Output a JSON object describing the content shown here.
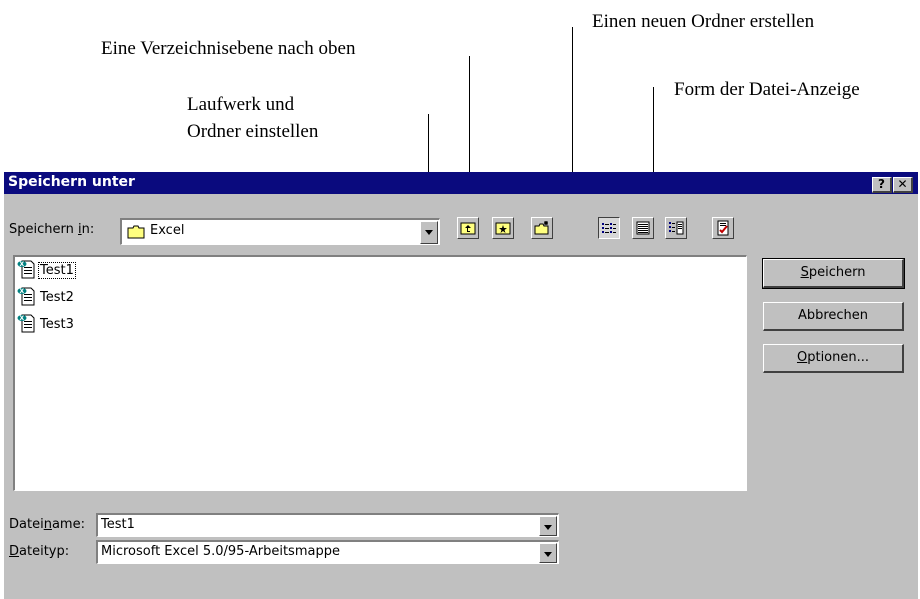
{
  "annotations": {
    "new_folder": "Einen neuen Ordner erstellen",
    "up_one_level": "Eine Verzeichnisebene nach oben",
    "view_mode": "Form der Datei-Anzeige",
    "drive_folder_line1": "Laufwerk und",
    "drive_folder_line2": "Ordner  einstellen"
  },
  "dialog": {
    "title": "Speichern unter",
    "help_glyph": "?",
    "close_glyph": "✕",
    "save_in_label_pre": "Speichern ",
    "save_in_label_u": "i",
    "save_in_label_post": "n:",
    "save_in_value": "Excel",
    "files": [
      "Test1",
      "Test2",
      "Test3"
    ],
    "filename_label_pre": "Datei",
    "filename_label_u": "n",
    "filename_label_post": "ame:",
    "filename_value": "Test1",
    "filetype_label_u": "D",
    "filetype_label_post": "ateityp:",
    "filetype_value": "Microsoft Excel 5.0/95-Arbeitsmappe",
    "buttons": {
      "save_u": "S",
      "save_post": "peichern",
      "cancel": "Abbrechen",
      "options_u": "O",
      "options_post": "ptionen..."
    }
  },
  "colors": {
    "titlebar": "#0a0a7e",
    "dialog_face": "#c0c0c0",
    "folder_yellow": "#ffff80"
  },
  "icons": [
    "folder-icon",
    "up-folder-icon",
    "favorites-icon",
    "new-folder-icon",
    "list-view-icon",
    "details-view-icon",
    "properties-view-icon",
    "commands-icon",
    "excel-file-icon"
  ]
}
